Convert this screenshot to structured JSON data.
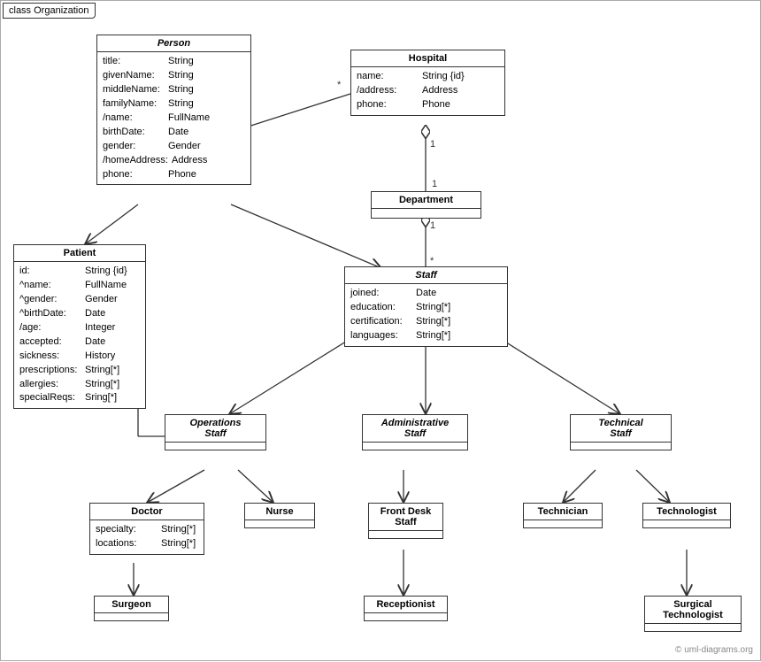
{
  "title": "class Organization",
  "watermark": "© uml-diagrams.org",
  "boxes": {
    "person": {
      "title": "Person",
      "fields": [
        {
          "name": "title:",
          "type": "String"
        },
        {
          "name": "givenName:",
          "type": "String"
        },
        {
          "name": "middleName:",
          "type": "String"
        },
        {
          "name": "familyName:",
          "type": "String"
        },
        {
          "name": "/name:",
          "type": "FullName"
        },
        {
          "name": "birthDate:",
          "type": "Date"
        },
        {
          "name": "gender:",
          "type": "Gender"
        },
        {
          "name": "/homeAddress:",
          "type": "Address"
        },
        {
          "name": "phone:",
          "type": "Phone"
        }
      ]
    },
    "hospital": {
      "title": "Hospital",
      "fields": [
        {
          "name": "name:",
          "type": "String {id}"
        },
        {
          "name": "/address:",
          "type": "Address"
        },
        {
          "name": "phone:",
          "type": "Phone"
        }
      ]
    },
    "department": {
      "title": "Department",
      "fields": []
    },
    "staff": {
      "title": "Staff",
      "fields": [
        {
          "name": "joined:",
          "type": "Date"
        },
        {
          "name": "education:",
          "type": "String[*]"
        },
        {
          "name": "certification:",
          "type": "String[*]"
        },
        {
          "name": "languages:",
          "type": "String[*]"
        }
      ]
    },
    "patient": {
      "title": "Patient",
      "fields": [
        {
          "name": "id:",
          "type": "String {id}"
        },
        {
          "name": "^name:",
          "type": "FullName"
        },
        {
          "name": "^gender:",
          "type": "Gender"
        },
        {
          "name": "^birthDate:",
          "type": "Date"
        },
        {
          "name": "/age:",
          "type": "Integer"
        },
        {
          "name": "accepted:",
          "type": "Date"
        },
        {
          "name": "sickness:",
          "type": "History"
        },
        {
          "name": "prescriptions:",
          "type": "String[*]"
        },
        {
          "name": "allergies:",
          "type": "String[*]"
        },
        {
          "name": "specialReqs:",
          "type": "Sring[*]"
        }
      ]
    },
    "operations_staff": {
      "title": "Operations\nStaff",
      "italic": true
    },
    "administrative_staff": {
      "title": "Administrative\nStaff",
      "italic": true
    },
    "technical_staff": {
      "title": "Technical\nStaff",
      "italic": true
    },
    "doctor": {
      "title": "Doctor",
      "fields": [
        {
          "name": "specialty:",
          "type": "String[*]"
        },
        {
          "name": "locations:",
          "type": "String[*]"
        }
      ]
    },
    "nurse": {
      "title": "Nurse",
      "fields": []
    },
    "front_desk_staff": {
      "title": "Front Desk\nStaff",
      "fields": []
    },
    "technician": {
      "title": "Technician",
      "fields": []
    },
    "technologist": {
      "title": "Technologist",
      "fields": []
    },
    "surgeon": {
      "title": "Surgeon",
      "fields": []
    },
    "receptionist": {
      "title": "Receptionist",
      "fields": []
    },
    "surgical_technologist": {
      "title": "Surgical\nTechnologist",
      "fields": []
    }
  }
}
